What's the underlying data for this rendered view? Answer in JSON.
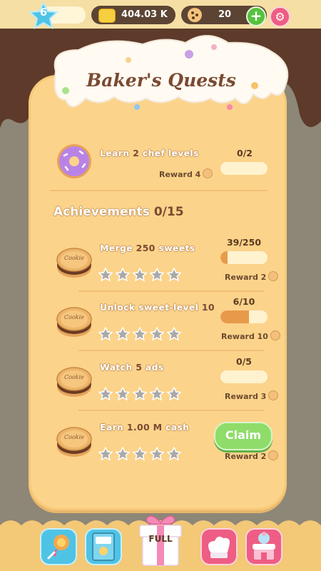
{
  "header": {
    "level": "6",
    "cash": "404.03 K",
    "cookies": "20"
  },
  "title": "Baker's Quests",
  "quest": {
    "text_pre": "Learn",
    "number": "2",
    "text_post": "chef levels",
    "progress": "0/2",
    "progress_fraction": 0,
    "reward": "Reward 4"
  },
  "achievements": {
    "label": "Achievements",
    "count": "0/15",
    "items": [
      {
        "text_pre": "Merge",
        "number": "250",
        "text_post": "sweets",
        "progress": "39/250",
        "progress_fraction": 0.156,
        "reward": "Reward 2",
        "stars": 5
      },
      {
        "text_pre": "Unlock sweet-level",
        "number": "10",
        "text_post": "",
        "progress": "6/10",
        "progress_fraction": 0.6,
        "reward": "Reward 10",
        "stars": 5
      },
      {
        "text_pre": "Watch",
        "number": "5",
        "text_post": "ads",
        "progress": "0/5",
        "progress_fraction": 0,
        "reward": "Reward 3",
        "stars": 5
      },
      {
        "text_pre": "Earn",
        "number": "1.00 M",
        "text_post": "cash",
        "claim_label": "Claim",
        "reward": "Reward 2",
        "stars": 5
      }
    ]
  },
  "cookie_label": "Cookie",
  "bottom": {
    "gift_label": "FULL"
  },
  "colors": {
    "panel": "#fcd38a",
    "accent_brown": "#7a4a32",
    "claim_green": "#8fdc6a",
    "progress_fill": "#e89a4a"
  }
}
